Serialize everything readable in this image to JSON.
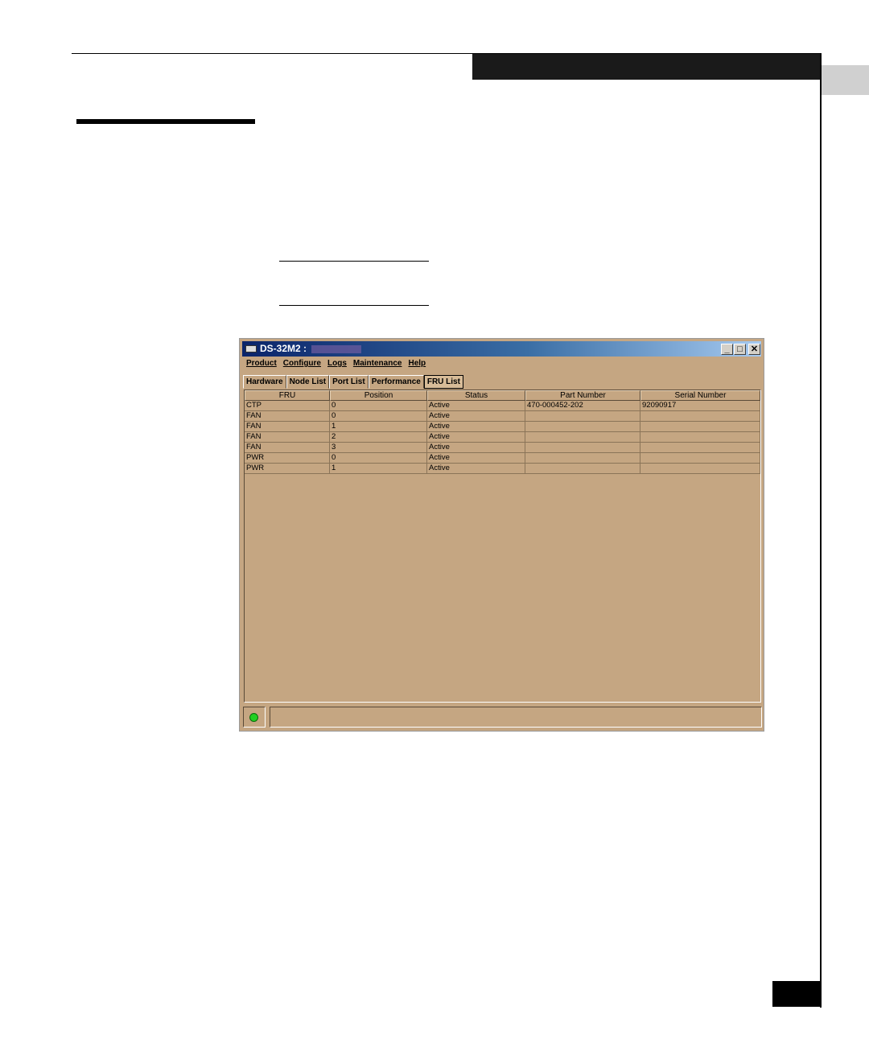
{
  "window": {
    "title": "DS-32M2 :",
    "buttons": {
      "minimize": "_",
      "maximize": "□",
      "close": "✕"
    }
  },
  "menu": [
    "Product",
    "Configure",
    "Logs",
    "Maintenance",
    "Help"
  ],
  "tabs": [
    "Hardware",
    "Node List",
    "Port List",
    "Performance",
    "FRU List"
  ],
  "active_tab": "FRU List",
  "table": {
    "columns": [
      "FRU",
      "Position",
      "Status",
      "Part Number",
      "Serial Number"
    ],
    "rows": [
      [
        "CTP",
        "0",
        "Active",
        "470-000452-202",
        "92090917"
      ],
      [
        "FAN",
        "0",
        "Active",
        "",
        ""
      ],
      [
        "FAN",
        "1",
        "Active",
        "",
        ""
      ],
      [
        "FAN",
        "2",
        "Active",
        "",
        ""
      ],
      [
        "FAN",
        "3",
        "Active",
        "",
        ""
      ],
      [
        "PWR",
        "0",
        "Active",
        "",
        ""
      ],
      [
        "PWR",
        "1",
        "Active",
        "",
        ""
      ]
    ]
  },
  "status": {
    "led_color": "#22d022"
  }
}
